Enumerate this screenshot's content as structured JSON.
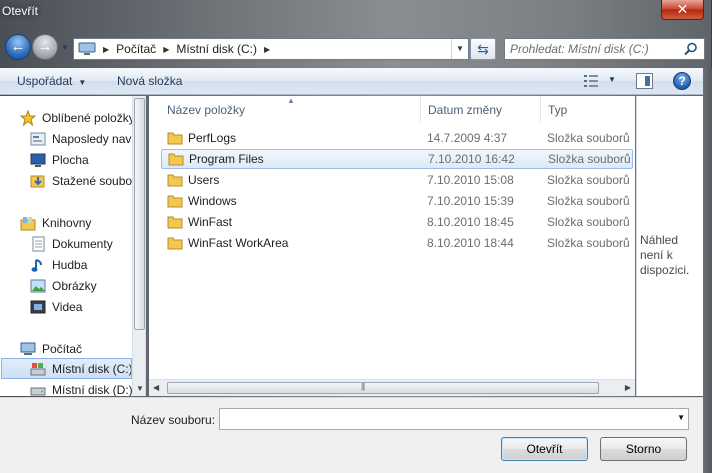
{
  "window": {
    "title": "Otevřít",
    "close_label": "✕"
  },
  "address": {
    "crumbs": [
      "Počítač",
      "Místní disk (C:)"
    ]
  },
  "search": {
    "placeholder": "Prohledat: Místní disk (C:)"
  },
  "toolbar": {
    "organize_label": "Uspořádat",
    "new_folder_label": "Nová složka",
    "help_label": "?"
  },
  "navigation": {
    "items": [
      {
        "label": "Oblíbené položky",
        "icon": "star-icon",
        "group": true
      },
      {
        "label": "Naposledy navštívené",
        "icon": "recent-places-icon"
      },
      {
        "label": "Plocha",
        "icon": "desktop-icon"
      },
      {
        "label": "Stažené soubory",
        "icon": "downloads-icon"
      },
      {
        "label": "Knihovny",
        "icon": "libraries-icon",
        "group": true
      },
      {
        "label": "Dokumenty",
        "icon": "documents-icon"
      },
      {
        "label": "Hudba",
        "icon": "music-icon"
      },
      {
        "label": "Obrázky",
        "icon": "pictures-icon"
      },
      {
        "label": "Videa",
        "icon": "videos-icon"
      },
      {
        "label": "Počítač",
        "icon": "computer-icon",
        "group": true
      },
      {
        "label": "Místní disk (C:)",
        "icon": "drive-c-icon",
        "selected": true
      },
      {
        "label": "Místní disk (D:)",
        "icon": "drive-icon"
      }
    ]
  },
  "files": {
    "columns": [
      "Název položky",
      "Datum změny",
      "Typ"
    ],
    "rows": [
      {
        "name": "PerfLogs",
        "date": "14.7.2009 4:37",
        "type": "Složka souborů"
      },
      {
        "name": "Program Files",
        "date": "7.10.2010 16:42",
        "type": "Složka souborů",
        "selected": true
      },
      {
        "name": "Users",
        "date": "7.10.2010 15:08",
        "type": "Složka souborů"
      },
      {
        "name": "Windows",
        "date": "7.10.2010 15:39",
        "type": "Složka souborů"
      },
      {
        "name": "WinFast",
        "date": "8.10.2010 18:45",
        "type": "Složka souborů"
      },
      {
        "name": "WinFast WorkArea",
        "date": "8.10.2010 18:44",
        "type": "Složka souborů"
      }
    ]
  },
  "preview": {
    "text": "Náhled není k dispozici."
  },
  "filename": {
    "label": "Název souboru:",
    "value": ""
  },
  "buttons": {
    "open": "Otevřít",
    "cancel": "Storno"
  },
  "colors": {
    "accent": "#2d6cc0",
    "folder": "#f2c94c",
    "selection": "#cddff5"
  }
}
